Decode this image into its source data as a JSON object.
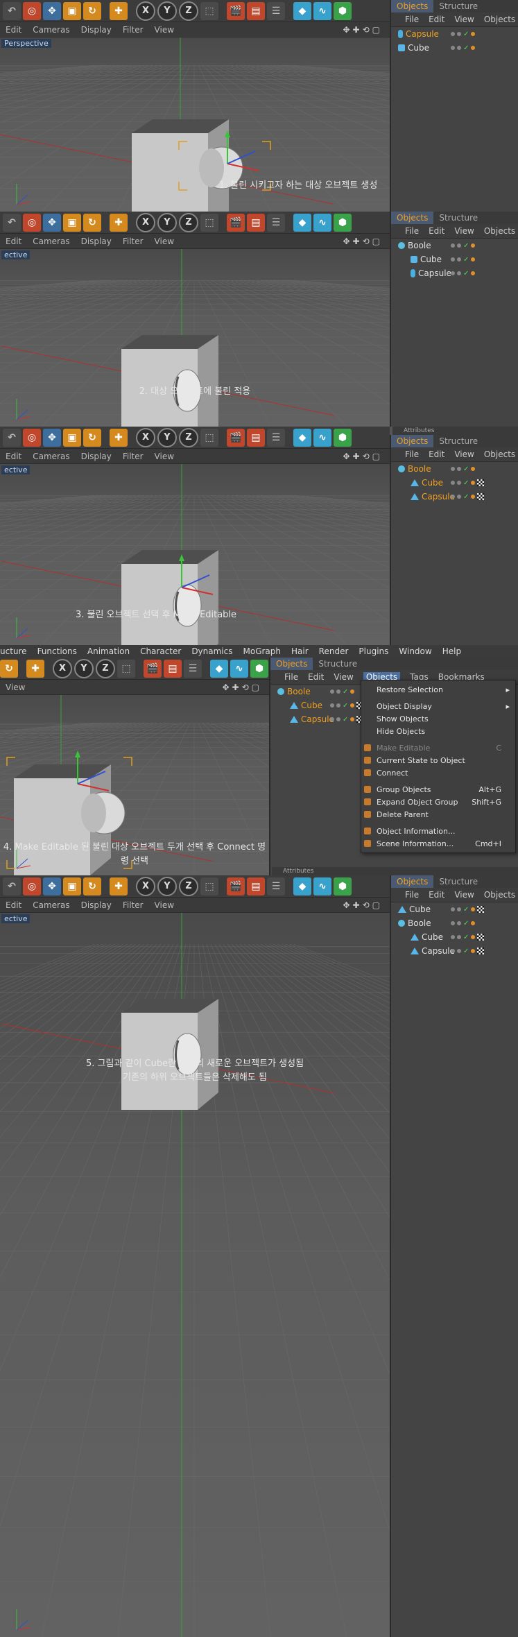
{
  "toolbar_axes": [
    "X",
    "Y",
    "Z"
  ],
  "viewport_menu": [
    "Edit",
    "Cameras",
    "Display",
    "Filter",
    "View"
  ],
  "viewport_label_full": "Perspective",
  "viewport_label_cut": "ective",
  "object_tabs": [
    "Objects",
    "Structure"
  ],
  "object_menu": [
    "File",
    "Edit",
    "View",
    "Objects"
  ],
  "attributes_label": "Attributes",
  "main_menu": [
    "ucture",
    "Functions",
    "Animation",
    "Character",
    "Dynamics",
    "MoGraph",
    "Hair",
    "Render",
    "Plugins",
    "Window",
    "Help"
  ],
  "panel4_vpmenu": [
    "View"
  ],
  "panel4_objmenu": [
    "File",
    "Edit",
    "View",
    "Objects",
    "Tags",
    "Bookmarks"
  ],
  "panels": [
    {
      "caption": "1. 불린 시키고자 하는 대상 오브젝트 생성",
      "objects": [
        {
          "name": "Capsule",
          "icon": "capsule",
          "selected": true,
          "indent": 0
        },
        {
          "name": "Cube",
          "icon": "cube",
          "selected": false,
          "indent": 0
        }
      ]
    },
    {
      "caption": "2. 대상 오브젝트에 불린 적용",
      "objects": [
        {
          "name": "Boole",
          "icon": "boole",
          "selected": false,
          "indent": 0
        },
        {
          "name": "Cube",
          "icon": "cube",
          "selected": false,
          "indent": 1
        },
        {
          "name": "Capsule",
          "icon": "capsule",
          "selected": false,
          "indent": 1
        }
      ]
    },
    {
      "caption": "3. 불린 오브젝트 선택 후 Make Editable",
      "objects": [
        {
          "name": "Boole",
          "icon": "boole",
          "selected": true,
          "indent": 0
        },
        {
          "name": "Cube",
          "icon": "poly",
          "selected": true,
          "indent": 1
        },
        {
          "name": "Capsule",
          "icon": "poly",
          "selected": true,
          "indent": 1
        }
      ]
    },
    {
      "caption": "4. Make Editable 된 불린 대상 오브젝트 두개 선택 후 Connect 명령 선택",
      "objects": [
        {
          "name": "Boole",
          "icon": "boole",
          "selected": true,
          "indent": 0
        },
        {
          "name": "Cube",
          "icon": "poly",
          "selected": true,
          "indent": 1
        },
        {
          "name": "Capsule",
          "icon": "poly",
          "selected": true,
          "indent": 1
        }
      ]
    },
    {
      "caption_line1": "5. 그림과 같이 Cube란 이름의 새로운 오브젝트가 생성됨",
      "caption_line2": "기존의 하위 오브젝트들은 삭제해도 됨",
      "objects": [
        {
          "name": "Cube",
          "icon": "poly",
          "selected": false,
          "indent": 0
        },
        {
          "name": "Boole",
          "icon": "boole",
          "selected": false,
          "indent": 0
        },
        {
          "name": "Cube",
          "icon": "poly",
          "selected": false,
          "indent": 1
        },
        {
          "name": "Capsule",
          "icon": "poly",
          "selected": false,
          "indent": 1
        }
      ]
    }
  ],
  "context_menu": [
    {
      "label": "Restore Selection",
      "shortcut": "",
      "submenu": true,
      "disabled": false
    },
    {
      "sep": true
    },
    {
      "label": "Object Display",
      "shortcut": "",
      "submenu": true,
      "disabled": false
    },
    {
      "label": "Show Objects",
      "shortcut": "",
      "submenu": false,
      "disabled": false
    },
    {
      "label": "Hide Objects",
      "shortcut": "",
      "submenu": false,
      "disabled": false
    },
    {
      "sep": true
    },
    {
      "label": "Make Editable",
      "shortcut": "C",
      "submenu": false,
      "disabled": true
    },
    {
      "label": "Current State to Object",
      "shortcut": "",
      "submenu": false,
      "disabled": false
    },
    {
      "label": "Connect",
      "shortcut": "",
      "submenu": false,
      "disabled": false
    },
    {
      "sep": true
    },
    {
      "label": "Group Objects",
      "shortcut": "Alt+G",
      "submenu": false,
      "disabled": false
    },
    {
      "label": "Expand Object Group",
      "shortcut": "Shift+G",
      "submenu": false,
      "disabled": false
    },
    {
      "label": "Delete Parent",
      "shortcut": "",
      "submenu": false,
      "disabled": false
    },
    {
      "sep": true
    },
    {
      "label": "Object Information...",
      "shortcut": "",
      "submenu": false,
      "disabled": false
    },
    {
      "label": "Scene Information...",
      "shortcut": "Cmd+I",
      "submenu": false,
      "disabled": false
    }
  ]
}
